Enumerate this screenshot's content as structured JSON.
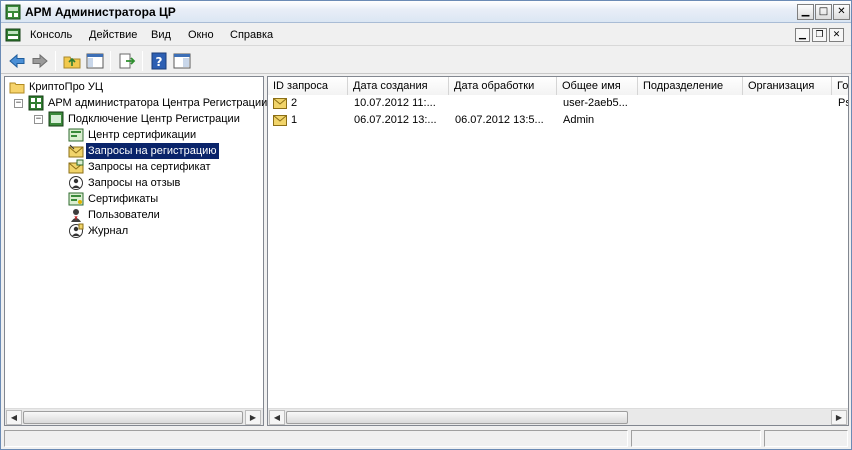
{
  "window": {
    "title": "АРМ Администратора ЦР"
  },
  "menu": {
    "items": [
      {
        "label": "Консоль"
      },
      {
        "label": "Действие"
      },
      {
        "label": "Вид"
      },
      {
        "label": "Окно"
      },
      {
        "label": "Справка"
      }
    ]
  },
  "toolbar": {
    "icons": [
      "back-arrow-icon",
      "forward-arrow-icon",
      "up-folder-icon",
      "show-hide-tree-icon",
      "export-list-icon",
      "help-icon",
      "properties-pane-icon"
    ]
  },
  "tree": {
    "root": "КриптоПро УЦ",
    "nodes": [
      {
        "label": "АРМ администратора Центра Регистрации"
      },
      {
        "label": "Подключение Центр Регистрации"
      },
      {
        "label": "Центр сертификации"
      },
      {
        "label": "Запросы на регистрацию"
      },
      {
        "label": "Запросы на сертификат"
      },
      {
        "label": "Запросы на отзыв"
      },
      {
        "label": "Сертификаты"
      },
      {
        "label": "Пользователи"
      },
      {
        "label": "Журнал"
      }
    ],
    "selected": "Запросы на регистрацию"
  },
  "list": {
    "columns": [
      "ID запроса",
      "Дата создания",
      "Дата обработки",
      "Общее имя",
      "Подразделение",
      "Организация",
      "Го"
    ],
    "rows": [
      {
        "id": "2",
        "created": "10.07.2012 11:...",
        "processed": "",
        "cn": "user-2aeb5...",
        "dept": "",
        "org": "",
        "extra": "Ps"
      },
      {
        "id": "1",
        "created": "06.07.2012 13:...",
        "processed": "06.07.2012 13:5...",
        "cn": "Admin",
        "dept": "",
        "org": "",
        "extra": ""
      }
    ]
  },
  "colors": {
    "selection": "#0a246a",
    "window_bg": "#f0f0f0",
    "titlebar_text": "#000000"
  }
}
